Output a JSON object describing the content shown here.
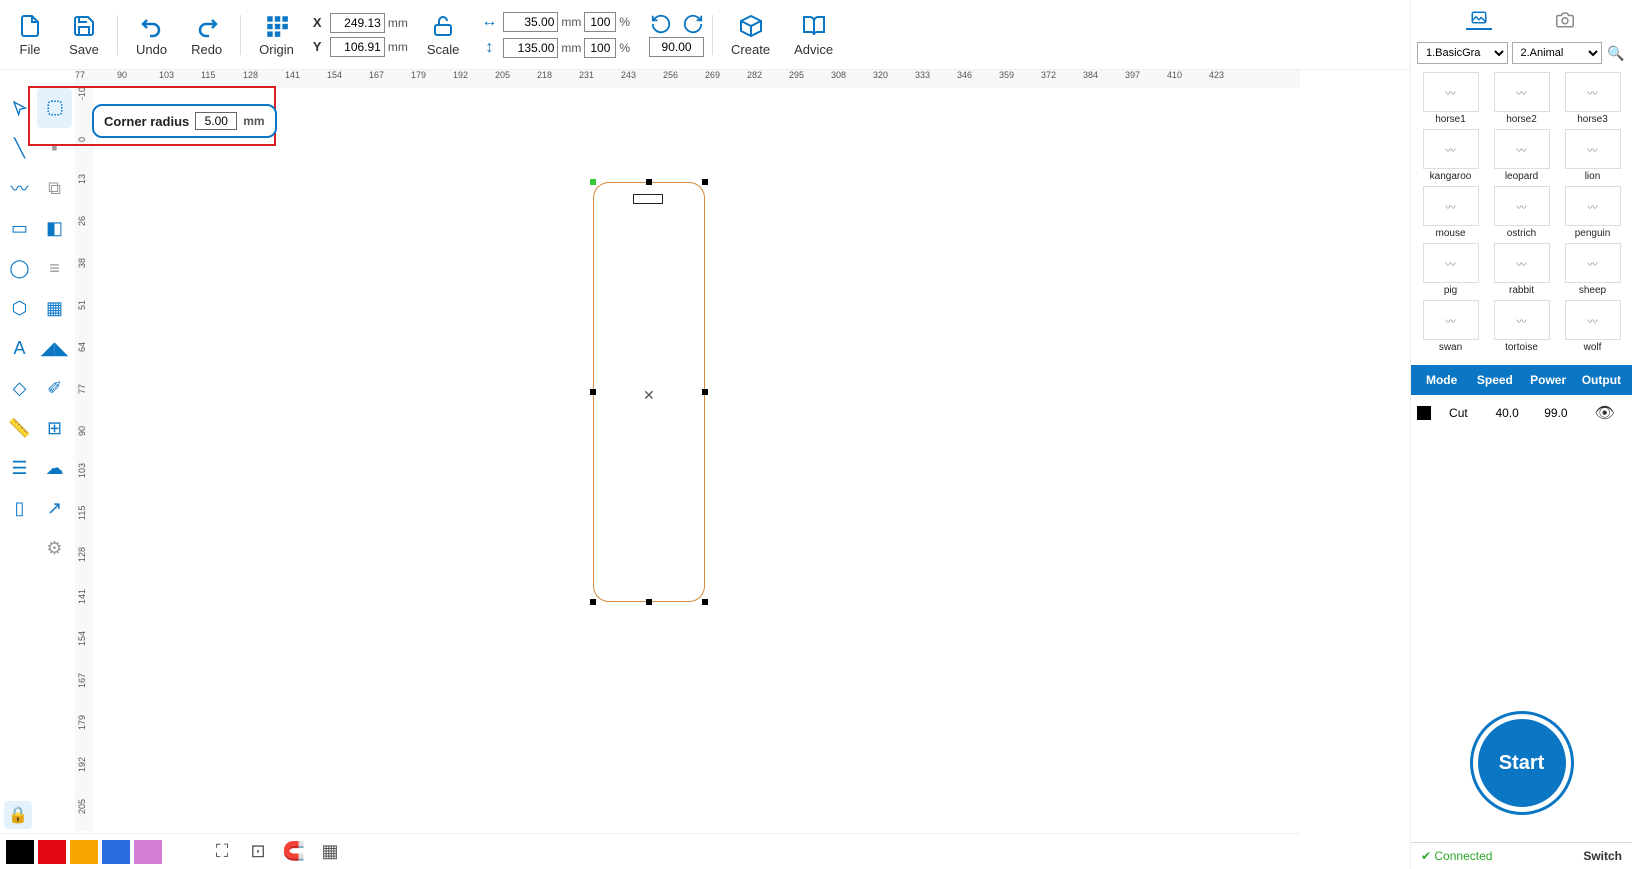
{
  "toolbar": {
    "file": "File",
    "save": "Save",
    "undo": "Undo",
    "redo": "Redo",
    "origin": "Origin",
    "scale": "Scale",
    "create": "Create",
    "advice": "Advice",
    "x_label": "X",
    "y_label": "Y",
    "x_value": "249.13",
    "y_value": "106.91",
    "mm": "mm",
    "width_value": "35.00",
    "height_value": "135.00",
    "pct": "%",
    "pct_w": "100",
    "pct_h": "100",
    "rotate_value": "90.00"
  },
  "corner_radius": {
    "label": "Corner radius",
    "value": "5.00",
    "unit": "mm"
  },
  "ruler_h": [
    "77",
    "90",
    "103",
    "115",
    "128",
    "141",
    "154",
    "167",
    "179",
    "192",
    "205",
    "218",
    "231",
    "243",
    "256",
    "269",
    "282",
    "295",
    "308",
    "320",
    "333",
    "346",
    "359",
    "372",
    "384",
    "397",
    "410",
    "423"
  ],
  "ruler_v": [
    "-10",
    "0",
    "13",
    "26",
    "38",
    "51",
    "64",
    "77",
    "90",
    "103",
    "115",
    "128",
    "141",
    "154",
    "167",
    "179",
    "192",
    "205"
  ],
  "library": {
    "select1": "1.BasicGra",
    "select2": "2.Animal",
    "items": [
      {
        "name": "horse1"
      },
      {
        "name": "horse2"
      },
      {
        "name": "horse3"
      },
      {
        "name": "kangaroo"
      },
      {
        "name": "leopard"
      },
      {
        "name": "lion"
      },
      {
        "name": "mouse"
      },
      {
        "name": "ostrich"
      },
      {
        "name": "penguin"
      },
      {
        "name": "pig"
      },
      {
        "name": "rabbit"
      },
      {
        "name": "sheep"
      },
      {
        "name": "swan"
      },
      {
        "name": "tortoise"
      },
      {
        "name": "wolf"
      }
    ]
  },
  "layers": {
    "headers": {
      "mode": "Mode",
      "speed": "Speed",
      "power": "Power",
      "output": "Output"
    },
    "row": {
      "mode": "Cut",
      "speed": "40.0",
      "power": "99.0"
    }
  },
  "start": "Start",
  "status": {
    "connected": "Connected",
    "switch": "Switch"
  },
  "bottom_colors": [
    "#000000",
    "#e30613",
    "#f7a600",
    "#2b6ce0",
    "#d47fd4"
  ]
}
